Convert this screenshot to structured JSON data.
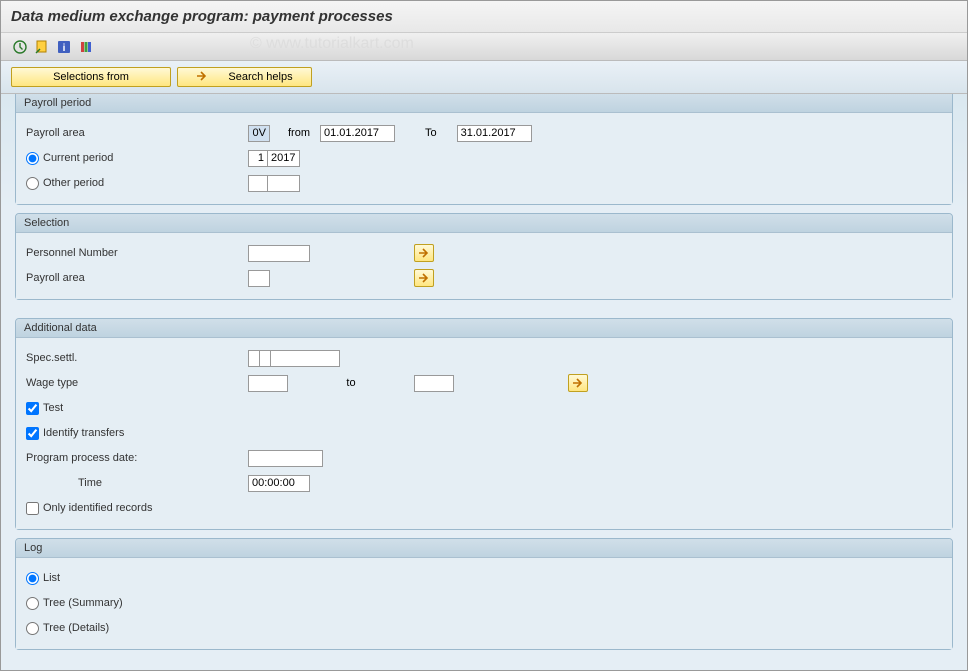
{
  "title": "Data medium exchange program: payment processes",
  "watermark": "© www.tutorialkart.com",
  "buttons": {
    "selections_from": "Selections from",
    "search_helps": "Search helps"
  },
  "groups": {
    "payroll_period": {
      "header": "Payroll period",
      "payroll_area_label": "Payroll area",
      "payroll_area_value": "0V",
      "from_label": "from",
      "from_value": "01.01.2017",
      "to_label": "To",
      "to_value": "31.01.2017",
      "current_period_label": "Current period",
      "current_period_num": "1",
      "current_period_year": "2017",
      "other_period_label": "Other period"
    },
    "selection": {
      "header": "Selection",
      "personnel_number_label": "Personnel Number",
      "payroll_area_label": "Payroll area"
    },
    "additional_data": {
      "header": "Additional data",
      "spec_settl_label": "Spec.settl.",
      "wage_type_label": "Wage type",
      "wage_type_to_label": "to",
      "test_label": "Test",
      "identify_transfers_label": "Identify transfers",
      "program_process_date_label": "Program process date:",
      "time_label": "Time",
      "time_value": "00:00:00",
      "only_identified_records_label": "Only identified records"
    },
    "log": {
      "header": "Log",
      "list_label": "List",
      "tree_summary_label": "Tree (Summary)",
      "tree_details_label": "Tree (Details)"
    }
  }
}
